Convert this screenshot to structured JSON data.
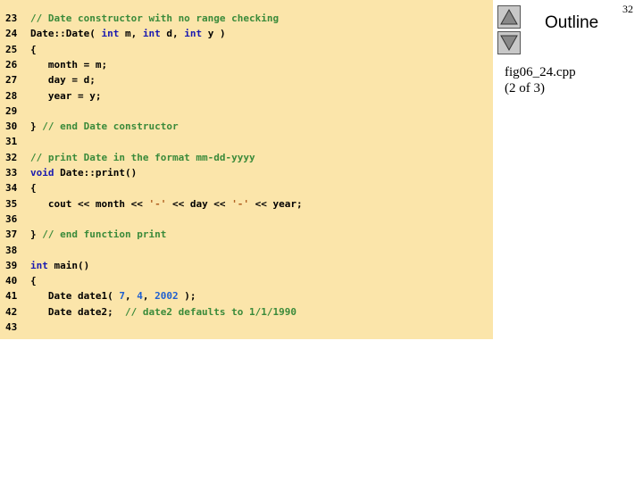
{
  "slide": {
    "outline_label": "Outline",
    "file_name": "fig06_24.cpp",
    "page_info": "(2 of 3)",
    "page_number": "32"
  },
  "nav": {
    "up_icon": "triangle-up-icon",
    "down_icon": "triangle-down-icon"
  },
  "colors": {
    "panel_background": "#fbe5aa",
    "keyword": "#1a1ab0",
    "comment": "#3a8a3a",
    "number": "#2060d0",
    "char_literal": "#b06020"
  },
  "code_lines": [
    {
      "num": "23",
      "segments": [
        {
          "t": "// Date constructor with no range checking",
          "c": "cm"
        }
      ]
    },
    {
      "num": "24",
      "segments": [
        {
          "t": "Date::Date( ",
          "c": "tx"
        },
        {
          "t": "int",
          "c": "kw"
        },
        {
          "t": " m, ",
          "c": "tx"
        },
        {
          "t": "int",
          "c": "kw"
        },
        {
          "t": " d, ",
          "c": "tx"
        },
        {
          "t": "int",
          "c": "kw"
        },
        {
          "t": " y )",
          "c": "tx"
        }
      ]
    },
    {
      "num": "25",
      "segments": [
        {
          "t": "{",
          "c": "tx"
        }
      ]
    },
    {
      "num": "26",
      "segments": [
        {
          "t": "   month = m;",
          "c": "tx"
        }
      ]
    },
    {
      "num": "27",
      "segments": [
        {
          "t": "   day = d;",
          "c": "tx"
        }
      ]
    },
    {
      "num": "28",
      "segments": [
        {
          "t": "   year = y;",
          "c": "tx"
        }
      ]
    },
    {
      "num": "29",
      "segments": []
    },
    {
      "num": "30",
      "segments": [
        {
          "t": "} ",
          "c": "tx"
        },
        {
          "t": "// end Date constructor",
          "c": "cm"
        }
      ]
    },
    {
      "num": "31",
      "segments": []
    },
    {
      "num": "32",
      "segments": [
        {
          "t": "// print Date in the format mm-dd-yyyy",
          "c": "cm"
        }
      ]
    },
    {
      "num": "33",
      "segments": [
        {
          "t": "void",
          "c": "kw"
        },
        {
          "t": " Date::print()",
          "c": "tx"
        }
      ]
    },
    {
      "num": "34",
      "segments": [
        {
          "t": "{",
          "c": "tx"
        }
      ]
    },
    {
      "num": "35",
      "segments": [
        {
          "t": "   cout << month << ",
          "c": "tx"
        },
        {
          "t": "'-'",
          "c": "sc"
        },
        {
          "t": " << day << ",
          "c": "tx"
        },
        {
          "t": "'-'",
          "c": "sc"
        },
        {
          "t": " << year;",
          "c": "tx"
        }
      ]
    },
    {
      "num": "36",
      "segments": []
    },
    {
      "num": "37",
      "segments": [
        {
          "t": "} ",
          "c": "tx"
        },
        {
          "t": "// end function print",
          "c": "cm"
        }
      ]
    },
    {
      "num": "38",
      "segments": []
    },
    {
      "num": "39",
      "segments": [
        {
          "t": "int",
          "c": "kw"
        },
        {
          "t": " main()",
          "c": "tx"
        }
      ]
    },
    {
      "num": "40",
      "segments": [
        {
          "t": "{",
          "c": "tx"
        }
      ]
    },
    {
      "num": "41",
      "segments": [
        {
          "t": "   Date date1( ",
          "c": "tx"
        },
        {
          "t": "7",
          "c": "num"
        },
        {
          "t": ", ",
          "c": "tx"
        },
        {
          "t": "4",
          "c": "num"
        },
        {
          "t": ", ",
          "c": "tx"
        },
        {
          "t": "2002",
          "c": "num"
        },
        {
          "t": " );",
          "c": "tx"
        }
      ]
    },
    {
      "num": "42",
      "segments": [
        {
          "t": "   Date date2;  ",
          "c": "tx"
        },
        {
          "t": "// date2 defaults to 1/1/1990",
          "c": "cm"
        }
      ]
    },
    {
      "num": "43",
      "segments": []
    }
  ]
}
